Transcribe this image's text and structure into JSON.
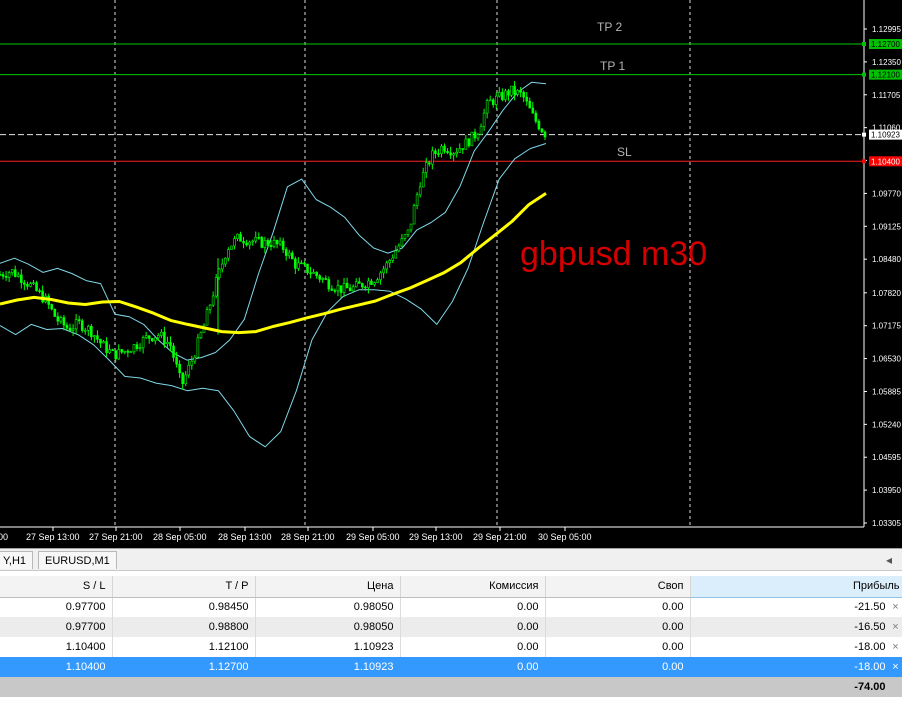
{
  "chart": {
    "annotation": "gbpusd m30",
    "level_labels": {
      "tp2": "TP 2",
      "tp1": "TP 1",
      "sl": "SL"
    },
    "price_axis": [
      "1.12995",
      "1.12350",
      "1.11705",
      "1.11060",
      "1.10415",
      "1.09770",
      "1.09125",
      "1.08480",
      "1.07820",
      "1.07175",
      "1.06530",
      "1.05885",
      "1.05240",
      "1.04595",
      "1.03950",
      "1.03305"
    ],
    "time_axis": [
      "27 Sep 13:00",
      "27 Sep 21:00",
      "28 Sep 05:00",
      "28 Sep 13:00",
      "28 Sep 21:00",
      "29 Sep 05:00",
      "29 Sep 13:00",
      "29 Sep 21:00",
      "30 Sep 05:00"
    ],
    "time_axis_partial": "00",
    "price_tags": [
      {
        "text": "1.12700",
        "kind": "tp2",
        "color": "#00c000"
      },
      {
        "text": "1.12100",
        "kind": "tp1",
        "color": "#00c000"
      },
      {
        "text": "1.10923",
        "kind": "bid",
        "color": "#ffffff"
      },
      {
        "text": "1.10400",
        "kind": "sl",
        "color": "#ff0000"
      }
    ],
    "colors": {
      "candle": "#00ff00",
      "ma": "#ffff00",
      "bands": "#7fd8e8",
      "tp_line": "#00c800",
      "sl_line": "#ff2020",
      "annotation": "#d40000"
    }
  },
  "tabs": [
    {
      "label": "Y,H1"
    },
    {
      "label": "EURUSD,M1"
    }
  ],
  "table": {
    "headers": [
      "S / L",
      "T / P",
      "Цена",
      "Комиссия",
      "Своп",
      "Прибыль"
    ],
    "rows": [
      {
        "sl": "0.97700",
        "tp": "0.98450",
        "price": "0.98050",
        "commission": "0.00",
        "swap": "0.00",
        "profit": "-21.50"
      },
      {
        "sl": "0.97700",
        "tp": "0.98800",
        "price": "0.98050",
        "commission": "0.00",
        "swap": "0.00",
        "profit": "-16.50"
      },
      {
        "sl": "1.10400",
        "tp": "1.12100",
        "price": "1.10923",
        "commission": "0.00",
        "swap": "0.00",
        "profit": "-18.00"
      },
      {
        "sl": "1.10400",
        "tp": "1.12700",
        "price": "1.10923",
        "commission": "0.00",
        "swap": "0.00",
        "profit": "-18.00"
      }
    ],
    "total": "-74.00",
    "close_glyph": "×"
  },
  "chart_data": {
    "type": "candlestick",
    "title": "gbpusd m30",
    "xlabel": "",
    "ylabel": "",
    "ylim": [
      1.03305,
      1.1332
    ],
    "time_ticks": [
      "27 Sep 13:00",
      "27 Sep 21:00",
      "28 Sep 05:00",
      "28 Sep 13:00",
      "28 Sep 21:00",
      "29 Sep 05:00",
      "29 Sep 13:00",
      "29 Sep 21:00",
      "30 Sep 05:00"
    ],
    "levels": [
      {
        "name": "TP 2",
        "value": 1.127
      },
      {
        "name": "TP 1",
        "value": 1.121
      },
      {
        "name": "",
        "value": 1.10923
      },
      {
        "name": "SL",
        "value": 1.104
      }
    ],
    "price_path": [
      1.0818,
      1.0825,
      1.081,
      1.079,
      1.0768,
      1.073,
      1.0712,
      1.0722,
      1.0708,
      1.068,
      1.066,
      1.0668,
      1.068,
      1.0695,
      1.07,
      1.068,
      1.06,
      1.0655,
      1.072,
      1.08,
      1.087,
      1.089,
      1.0885,
      1.088,
      1.088,
      1.087,
      1.0838,
      1.0828,
      1.0815,
      1.08,
      1.079,
      1.079,
      1.08,
      1.081,
      1.0835,
      1.087,
      1.0902,
      1.1,
      1.105,
      1.107,
      1.106,
      1.1075,
      1.1095,
      1.1155,
      1.1165,
      1.1178,
      1.117,
      1.1125,
      1.1095
    ],
    "moving_average": [
      1.076,
      1.0768,
      1.0773,
      1.0769,
      1.0762,
      1.0759,
      1.0764,
      1.0765,
      1.0754,
      1.0742,
      1.0728,
      1.072,
      1.0713,
      1.0706,
      1.0704,
      1.0706,
      1.0716,
      1.0724,
      1.0733,
      1.0741,
      1.075,
      1.0758,
      1.0766,
      1.0779,
      1.0791,
      1.0806,
      1.0821,
      1.0841,
      1.0869,
      1.0895,
      1.0922,
      1.0955,
      1.0977
    ],
    "upper_band": [
      1.084,
      1.085,
      1.0838,
      1.0822,
      1.083,
      1.082,
      1.0806,
      1.08,
      1.074,
      1.0735,
      1.072,
      1.069,
      1.0665,
      1.065,
      1.0655,
      1.0665,
      1.069,
      1.073,
      1.082,
      1.09,
      1.099,
      1.1005,
      1.0965,
      1.095,
      1.093,
      1.0895,
      1.087,
      1.086,
      1.087,
      1.0905,
      1.092,
      1.094,
      1.099,
      1.106,
      1.1098,
      1.114,
      1.1175,
      1.1195,
      1.1192
    ],
    "lower_band": [
      1.0718,
      1.07,
      1.072,
      1.071,
      1.0712,
      1.07,
      1.068,
      1.065,
      1.0618,
      1.0615,
      1.0605,
      1.06,
      1.059,
      1.0595,
      1.059,
      1.055,
      1.05,
      1.048,
      1.051,
      1.059,
      1.069,
      1.0745,
      1.0775,
      1.0788,
      1.0788,
      1.0785,
      1.077,
      1.075,
      1.072,
      1.0765,
      1.083,
      1.092,
      1.1005,
      1.1045,
      1.1065,
      1.1075
    ]
  }
}
